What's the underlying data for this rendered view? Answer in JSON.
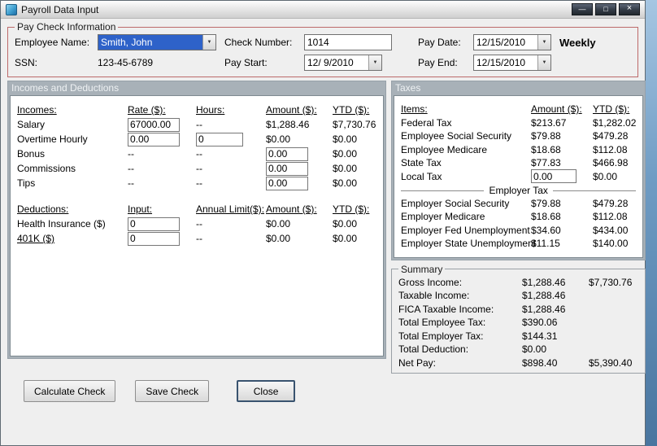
{
  "window": {
    "title": "Payroll Data Input",
    "controls": {
      "minimize": "—",
      "maximize": "□",
      "close": "×"
    }
  },
  "colors": {
    "selection_blue": "#2e62c9",
    "section_header_bg": "#a8b1b8",
    "paycheck_border": "#bd6a6a"
  },
  "paycheck": {
    "legend": "Pay Check Information",
    "employee_name": {
      "label": "Employee Name:",
      "value": "Smith, John"
    },
    "ssn": {
      "label": "SSN:",
      "value": "123-45-6789"
    },
    "check_number": {
      "label": "Check Number:",
      "value": "1014"
    },
    "pay_start": {
      "label": "Pay Start:",
      "value": "12/ 9/2010"
    },
    "pay_date": {
      "label": "Pay Date:",
      "value": "12/15/2010"
    },
    "pay_end": {
      "label": "Pay End:",
      "value": "12/15/2010"
    },
    "frequency": "Weekly"
  },
  "incomes_deductions": {
    "header": "Incomes and Deductions",
    "incomes": {
      "col_label": "Incomes:",
      "col_rate": "Rate ($):",
      "col_hours": "Hours:",
      "col_amount": "Amount ($):",
      "col_ytd": "YTD ($):",
      "salary": {
        "label": "Salary",
        "rate": "67000.00",
        "hours": "--",
        "amount": "$1,288.46",
        "ytd": "$7,730.76"
      },
      "overtime": {
        "label": "Overtime Hourly",
        "rate": "0.00",
        "hours": "0",
        "amount": "$0.00",
        "ytd": "$0.00"
      },
      "bonus": {
        "label": "Bonus",
        "rate": "--",
        "hours": "--",
        "amount": "0.00",
        "ytd": "$0.00"
      },
      "commissions": {
        "label": "Commissions",
        "rate": "--",
        "hours": "--",
        "amount": "0.00",
        "ytd": "$0.00"
      },
      "tips": {
        "label": "Tips",
        "rate": "--",
        "hours": "--",
        "amount": "0.00",
        "ytd": "$0.00"
      }
    },
    "deductions": {
      "col_label": "Deductions:",
      "col_input": "Input:",
      "col_limit": "Annual Limit($):",
      "col_amount": "Amount ($):",
      "col_ytd": "YTD ($):",
      "health": {
        "label": "Health Insurance  ($)",
        "input": "0",
        "limit": "--",
        "amount": "$0.00",
        "ytd": "$0.00"
      },
      "k401": {
        "label": "401K  ($)",
        "input": "0",
        "limit": "--",
        "amount": "$0.00",
        "ytd": "$0.00"
      }
    }
  },
  "taxes": {
    "header": "Taxes",
    "col_items": "Items:",
    "col_amount": "Amount ($):",
    "col_ytd": "YTD ($):",
    "federal": {
      "label": "Federal Tax",
      "amount": "$213.67",
      "ytd": "$1,282.02"
    },
    "emp_ss": {
      "label": "Employee Social Security",
      "amount": "$79.88",
      "ytd": "$479.28"
    },
    "emp_medicare": {
      "label": "Employee Medicare",
      "amount": "$18.68",
      "ytd": "$112.08"
    },
    "state": {
      "label": "State Tax",
      "amount": "$77.83",
      "ytd": "$466.98"
    },
    "local": {
      "label": "Local Tax",
      "amount": "0.00",
      "ytd": "$0.00"
    },
    "employer_divider": "Employer Tax",
    "er_ss": {
      "label": "Employer Social Security",
      "amount": "$79.88",
      "ytd": "$479.28"
    },
    "er_medicare": {
      "label": "Employer Medicare",
      "amount": "$18.68",
      "ytd": "$112.08"
    },
    "er_fed_unemp": {
      "label": "Employer Fed Unemployment",
      "amount": "$34.60",
      "ytd": "$434.00"
    },
    "er_state_unemp": {
      "label": "Employer State Unemployment",
      "amount": "$11.15",
      "ytd": "$140.00"
    }
  },
  "summary": {
    "legend": "Summary",
    "gross": {
      "label": "Gross Income:",
      "amount": "$1,288.46",
      "ytd": "$7,730.76"
    },
    "taxable": {
      "label": "Taxable Income:",
      "amount": "$1,288.46",
      "ytd": ""
    },
    "fica": {
      "label": "FICA Taxable Income:",
      "amount": "$1,288.46",
      "ytd": ""
    },
    "emp_tax": {
      "label": "Total Employee Tax:",
      "amount": "$390.06",
      "ytd": ""
    },
    "er_tax": {
      "label": "Total Employer Tax:",
      "amount": "$144.31",
      "ytd": ""
    },
    "deduction": {
      "label": "Total Deduction:",
      "amount": "$0.00",
      "ytd": ""
    },
    "net_pay": {
      "label": "Net Pay:",
      "amount": "$898.40",
      "ytd": "$5,390.40"
    }
  },
  "buttons": {
    "calculate": "Calculate Check",
    "save": "Save Check",
    "close": "Close"
  }
}
